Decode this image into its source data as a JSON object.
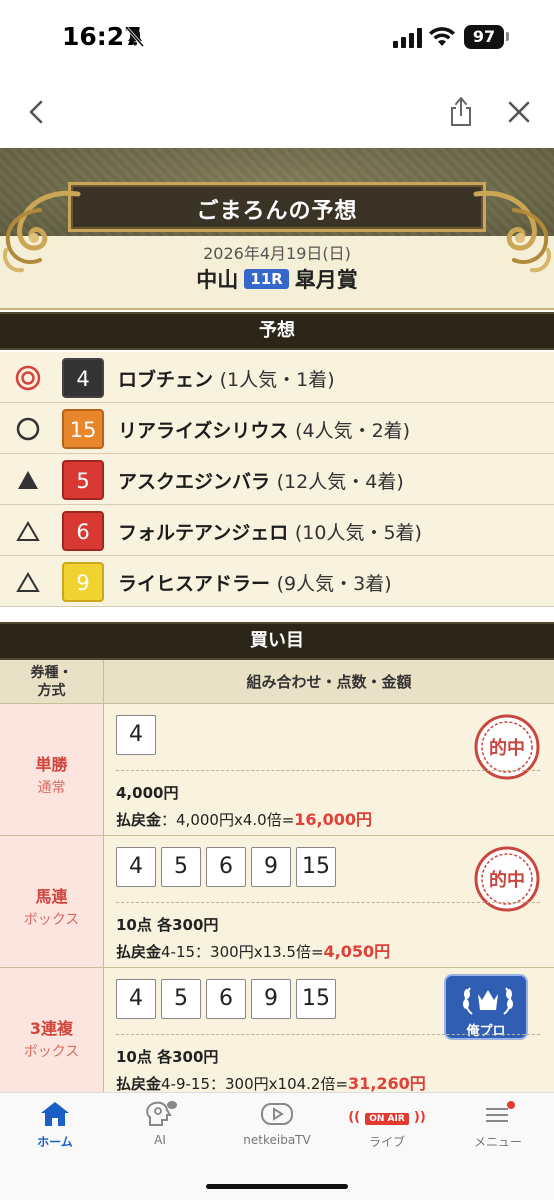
{
  "status": {
    "time": "16:27",
    "battery": "97"
  },
  "header": {
    "title": "ごまろんの予想",
    "date": "2026年4月19日(日)",
    "venue": "中山",
    "race_no": "11R",
    "race_name": "皐月賞"
  },
  "predictions": {
    "section_title": "予想",
    "rows": [
      {
        "mark": "double-circle",
        "num": "4",
        "color": "#333333",
        "name": "ロブチェン",
        "info": "(1人気・1着)"
      },
      {
        "mark": "circle",
        "num": "15",
        "color": "#e8862b",
        "name": "リアライズシリウス",
        "info": "(4人気・2着)"
      },
      {
        "mark": "filled-triangle",
        "num": "5",
        "color": "#d83a33",
        "name": "アスクエジンバラ",
        "info": "(12人気・4着)"
      },
      {
        "mark": "triangle",
        "num": "6",
        "color": "#d83a33",
        "name": "フォルテアンジェロ",
        "info": "(10人気・5着)"
      },
      {
        "mark": "triangle",
        "num": "9",
        "color": "#f0d230",
        "name": "ライヒスアドラー",
        "info": "(9人気・3着)"
      }
    ]
  },
  "bets": {
    "section_title": "買い目",
    "head_left": "券種・方式",
    "head_left_1": "券種・",
    "head_left_2": "方式",
    "head_right": "組み合わせ・点数・金額",
    "rows": [
      {
        "type": "単勝",
        "method": "通常",
        "horses": [
          "4"
        ],
        "amount": "4,000円",
        "payout_label": "払戻金",
        "payout_detail": "：4,000円x4.0倍=",
        "payout_total": "16,000円",
        "badge": "的中"
      },
      {
        "type": "馬連",
        "method": "ボックス",
        "horses": [
          "4",
          "5",
          "6",
          "9",
          "15"
        ],
        "amount": "10点 各300円",
        "payout_label": "払戻金",
        "payout_detail": "4-15：300円x13.5倍=",
        "payout_total": "4,050円",
        "badge": "的中"
      },
      {
        "type": "3連複",
        "method": "ボックス",
        "horses": [
          "4",
          "5",
          "6",
          "9",
          "15"
        ],
        "amount": "10点 各300円",
        "payout_label": "払戻金",
        "payout_detail": "4-9-15：300円x104.2倍=",
        "payout_total": "31,260円",
        "badge": "俺プロ"
      }
    ]
  },
  "tabs": [
    {
      "label": "ホーム",
      "icon": "home-icon"
    },
    {
      "label": "AI",
      "icon": "ai-head-icon"
    },
    {
      "label": "netkeibaTV",
      "icon": "play-icon"
    },
    {
      "label": "ライブ",
      "icon": "live-icon",
      "badge": "ON AIR"
    },
    {
      "label": "メニュー",
      "icon": "menu-icon"
    }
  ],
  "colors": {
    "accent_blue": "#1a5fc4",
    "win_red": "#e0403a",
    "section_dark": "#2b2617",
    "panel_cream": "#f8f2de"
  }
}
